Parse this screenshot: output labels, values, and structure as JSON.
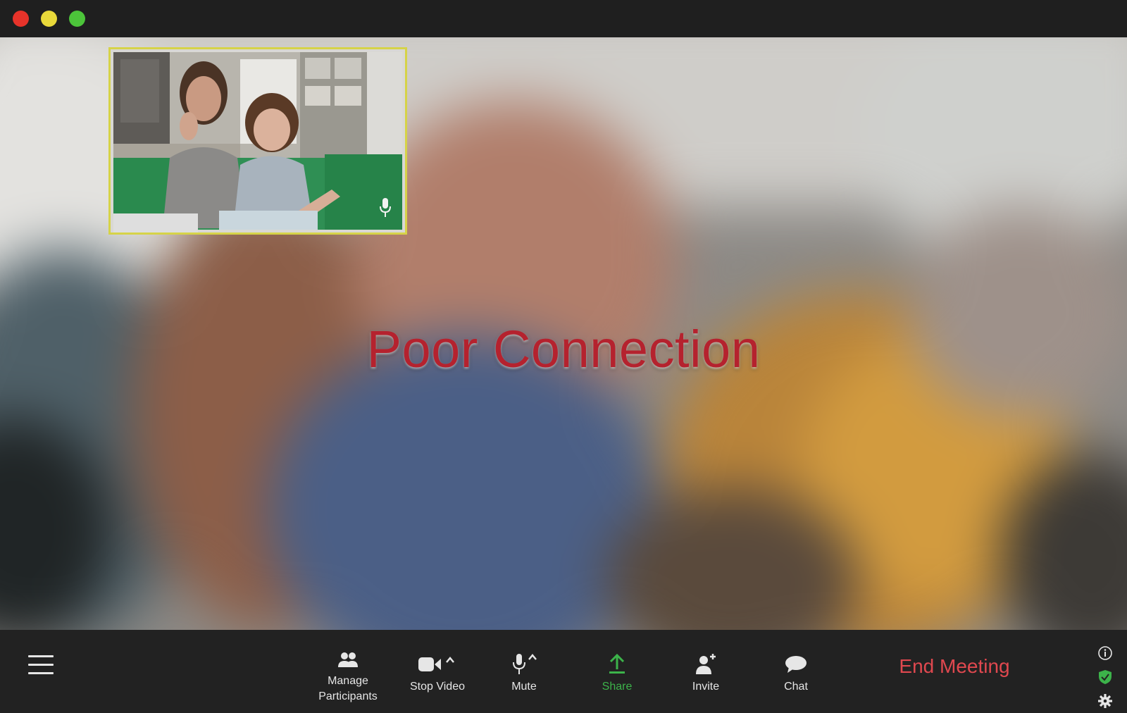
{
  "window": {
    "title_controls": [
      "close",
      "minimize",
      "maximize"
    ]
  },
  "main": {
    "status_text": "Poor Connection",
    "status_color": "#b5222e"
  },
  "self_view": {
    "border_color": "#d6d348",
    "mic_icon": "microphone-icon"
  },
  "toolbar": {
    "menu_icon": "hamburger-menu-icon",
    "manage_participants_line1": "Manage",
    "manage_participants_line2": "Participants",
    "stop_video_label": "Stop Video",
    "mute_label": "Mute",
    "share_label": "Share",
    "invite_label": "Invite",
    "chat_label": "Chat",
    "end_meeting_label": "End Meeting",
    "share_color": "#3cb34a",
    "end_meeting_color": "#e0484f"
  },
  "status_icons": [
    "info-icon",
    "shield-check-icon",
    "gear-icon"
  ]
}
